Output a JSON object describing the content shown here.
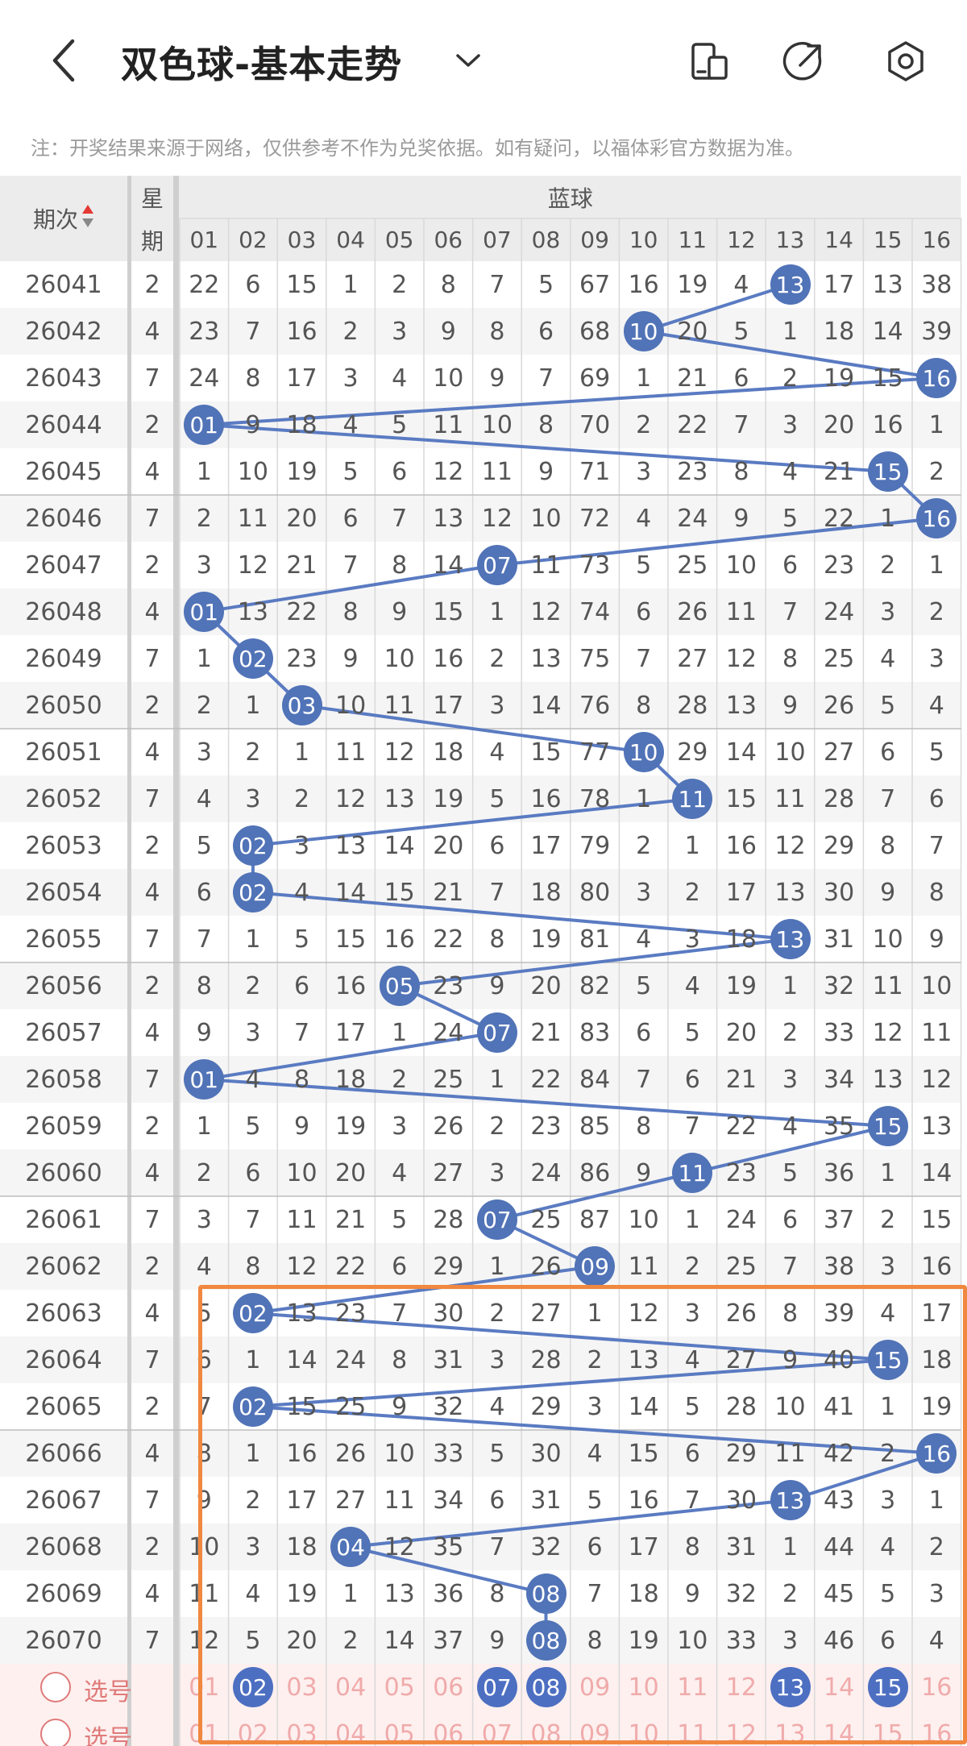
{
  "header": {
    "title": "双色球-基本走势",
    "back_icon": "back-arrow-icon",
    "dropdown_icon": "chevron-down-icon",
    "actions": [
      {
        "name": "device-icon"
      },
      {
        "name": "share-icon"
      },
      {
        "name": "settings-icon"
      }
    ]
  },
  "notice": "注：开奖结果来源于网络，仅供参考不作为兑奖依据。如有疑问，以福体彩官方数据为准。",
  "table": {
    "col_issue": "期次",
    "col_week_top": "星",
    "col_week_bottom": "期",
    "col_group": "蓝球",
    "numbers": [
      "01",
      "02",
      "03",
      "04",
      "05",
      "06",
      "07",
      "08",
      "09",
      "10",
      "11",
      "12",
      "13",
      "14",
      "15",
      "16"
    ],
    "rows": [
      {
        "issue": "26041",
        "week": "2",
        "cells": [
          "22",
          "6",
          "15",
          "1",
          "2",
          "8",
          "7",
          "5",
          "67",
          "16",
          "19",
          "4",
          "13",
          "17",
          "13",
          "38"
        ],
        "hit": 13
      },
      {
        "issue": "26042",
        "week": "4",
        "cells": [
          "23",
          "7",
          "16",
          "2",
          "3",
          "9",
          "8",
          "6",
          "68",
          "10",
          "20",
          "5",
          "1",
          "18",
          "14",
          "39"
        ],
        "hit": 10
      },
      {
        "issue": "26043",
        "week": "7",
        "cells": [
          "24",
          "8",
          "17",
          "3",
          "4",
          "10",
          "9",
          "7",
          "69",
          "1",
          "21",
          "6",
          "2",
          "19",
          "15",
          "16"
        ],
        "hit": 16
      },
      {
        "issue": "26044",
        "week": "2",
        "cells": [
          "01",
          "9",
          "18",
          "4",
          "5",
          "11",
          "10",
          "8",
          "70",
          "2",
          "22",
          "7",
          "3",
          "20",
          "16",
          "1"
        ],
        "hit": 1
      },
      {
        "issue": "26045",
        "week": "4",
        "cells": [
          "1",
          "10",
          "19",
          "5",
          "6",
          "12",
          "11",
          "9",
          "71",
          "3",
          "23",
          "8",
          "4",
          "21",
          "15",
          "2"
        ],
        "hit": 15
      },
      {
        "issue": "26046",
        "week": "7",
        "cells": [
          "2",
          "11",
          "20",
          "6",
          "7",
          "13",
          "12",
          "10",
          "72",
          "4",
          "24",
          "9",
          "5",
          "22",
          "1",
          "16"
        ],
        "hit": 16
      },
      {
        "issue": "26047",
        "week": "2",
        "cells": [
          "3",
          "12",
          "21",
          "7",
          "8",
          "14",
          "07",
          "11",
          "73",
          "5",
          "25",
          "10",
          "6",
          "23",
          "2",
          "1"
        ],
        "hit": 7
      },
      {
        "issue": "26048",
        "week": "4",
        "cells": [
          "01",
          "13",
          "22",
          "8",
          "9",
          "15",
          "1",
          "12",
          "74",
          "6",
          "26",
          "11",
          "7",
          "24",
          "3",
          "2"
        ],
        "hit": 1
      },
      {
        "issue": "26049",
        "week": "7",
        "cells": [
          "1",
          "02",
          "23",
          "9",
          "10",
          "16",
          "2",
          "13",
          "75",
          "7",
          "27",
          "12",
          "8",
          "25",
          "4",
          "3"
        ],
        "hit": 2
      },
      {
        "issue": "26050",
        "week": "2",
        "cells": [
          "2",
          "1",
          "03",
          "10",
          "11",
          "17",
          "3",
          "14",
          "76",
          "8",
          "28",
          "13",
          "9",
          "26",
          "5",
          "4"
        ],
        "hit": 3
      },
      {
        "issue": "26051",
        "week": "4",
        "cells": [
          "3",
          "2",
          "1",
          "11",
          "12",
          "18",
          "4",
          "15",
          "77",
          "10",
          "29",
          "14",
          "10",
          "27",
          "6",
          "5"
        ],
        "hit": 10
      },
      {
        "issue": "26052",
        "week": "7",
        "cells": [
          "4",
          "3",
          "2",
          "12",
          "13",
          "19",
          "5",
          "16",
          "78",
          "1",
          "11",
          "15",
          "11",
          "28",
          "7",
          "6"
        ],
        "hit": 11
      },
      {
        "issue": "26053",
        "week": "2",
        "cells": [
          "5",
          "02",
          "3",
          "13",
          "14",
          "20",
          "6",
          "17",
          "79",
          "2",
          "1",
          "16",
          "12",
          "29",
          "8",
          "7"
        ],
        "hit": 2
      },
      {
        "issue": "26054",
        "week": "4",
        "cells": [
          "6",
          "02",
          "4",
          "14",
          "15",
          "21",
          "7",
          "18",
          "80",
          "3",
          "2",
          "17",
          "13",
          "30",
          "9",
          "8"
        ],
        "hit": 2
      },
      {
        "issue": "26055",
        "week": "7",
        "cells": [
          "7",
          "1",
          "5",
          "15",
          "16",
          "22",
          "8",
          "19",
          "81",
          "4",
          "3",
          "18",
          "13",
          "31",
          "10",
          "9"
        ],
        "hit": 13
      },
      {
        "issue": "26056",
        "week": "2",
        "cells": [
          "8",
          "2",
          "6",
          "16",
          "05",
          "23",
          "9",
          "20",
          "82",
          "5",
          "4",
          "19",
          "1",
          "32",
          "11",
          "10"
        ],
        "hit": 5
      },
      {
        "issue": "26057",
        "week": "4",
        "cells": [
          "9",
          "3",
          "7",
          "17",
          "1",
          "24",
          "07",
          "21",
          "83",
          "6",
          "5",
          "20",
          "2",
          "33",
          "12",
          "11"
        ],
        "hit": 7
      },
      {
        "issue": "26058",
        "week": "7",
        "cells": [
          "01",
          "4",
          "8",
          "18",
          "2",
          "25",
          "1",
          "22",
          "84",
          "7",
          "6",
          "21",
          "3",
          "34",
          "13",
          "12"
        ],
        "hit": 1
      },
      {
        "issue": "26059",
        "week": "2",
        "cells": [
          "1",
          "5",
          "9",
          "19",
          "3",
          "26",
          "2",
          "23",
          "85",
          "8",
          "7",
          "22",
          "4",
          "35",
          "15",
          "13"
        ],
        "hit": 15
      },
      {
        "issue": "26060",
        "week": "4",
        "cells": [
          "2",
          "6",
          "10",
          "20",
          "4",
          "27",
          "3",
          "24",
          "86",
          "9",
          "11",
          "23",
          "5",
          "36",
          "1",
          "14"
        ],
        "hit": 11
      },
      {
        "issue": "26061",
        "week": "7",
        "cells": [
          "3",
          "7",
          "11",
          "21",
          "5",
          "28",
          "07",
          "25",
          "87",
          "10",
          "1",
          "24",
          "6",
          "37",
          "2",
          "15"
        ],
        "hit": 7
      },
      {
        "issue": "26062",
        "week": "2",
        "cells": [
          "4",
          "8",
          "12",
          "22",
          "6",
          "29",
          "1",
          "26",
          "09",
          "11",
          "2",
          "25",
          "7",
          "38",
          "3",
          "16"
        ],
        "hit": 9
      },
      {
        "issue": "26063",
        "week": "4",
        "cells": [
          "5",
          "02",
          "13",
          "23",
          "7",
          "30",
          "2",
          "27",
          "1",
          "12",
          "3",
          "26",
          "8",
          "39",
          "4",
          "17"
        ],
        "hit": 2
      },
      {
        "issue": "26064",
        "week": "7",
        "cells": [
          "6",
          "1",
          "14",
          "24",
          "8",
          "31",
          "3",
          "28",
          "2",
          "13",
          "4",
          "27",
          "9",
          "40",
          "15",
          "18"
        ],
        "hit": 15
      },
      {
        "issue": "26065",
        "week": "2",
        "cells": [
          "7",
          "02",
          "15",
          "25",
          "9",
          "32",
          "4",
          "29",
          "3",
          "14",
          "5",
          "28",
          "10",
          "41",
          "1",
          "19"
        ],
        "hit": 2
      },
      {
        "issue": "26066",
        "week": "4",
        "cells": [
          "8",
          "1",
          "16",
          "26",
          "10",
          "33",
          "5",
          "30",
          "4",
          "15",
          "6",
          "29",
          "11",
          "42",
          "2",
          "16"
        ],
        "hit": 16
      },
      {
        "issue": "26067",
        "week": "7",
        "cells": [
          "9",
          "2",
          "17",
          "27",
          "11",
          "34",
          "6",
          "31",
          "5",
          "16",
          "7",
          "30",
          "13",
          "43",
          "3",
          "1"
        ],
        "hit": 13
      },
      {
        "issue": "26068",
        "week": "2",
        "cells": [
          "10",
          "3",
          "18",
          "04",
          "12",
          "35",
          "7",
          "32",
          "6",
          "17",
          "8",
          "31",
          "1",
          "44",
          "4",
          "2"
        ],
        "hit": 4
      },
      {
        "issue": "26069",
        "week": "4",
        "cells": [
          "11",
          "4",
          "19",
          "1",
          "13",
          "36",
          "8",
          "08",
          "7",
          "18",
          "9",
          "32",
          "2",
          "45",
          "5",
          "3"
        ],
        "hit": 8
      },
      {
        "issue": "26070",
        "week": "7",
        "cells": [
          "12",
          "5",
          "20",
          "2",
          "14",
          "37",
          "9",
          "08",
          "8",
          "19",
          "10",
          "33",
          "3",
          "46",
          "6",
          "4"
        ],
        "hit": 8
      }
    ],
    "pick_rows": [
      {
        "label": "选号",
        "selected": [
          "02",
          "07",
          "08",
          "13",
          "15"
        ]
      },
      {
        "label": "选号",
        "selected": []
      }
    ]
  },
  "colors": {
    "ball": "#5173b7",
    "line": "#5a7bc2",
    "highlight_box": "#f0883f",
    "pick_text": "#f0aaaa",
    "pick_bg": "#fdf0ef",
    "header_bg": "#ececec"
  }
}
